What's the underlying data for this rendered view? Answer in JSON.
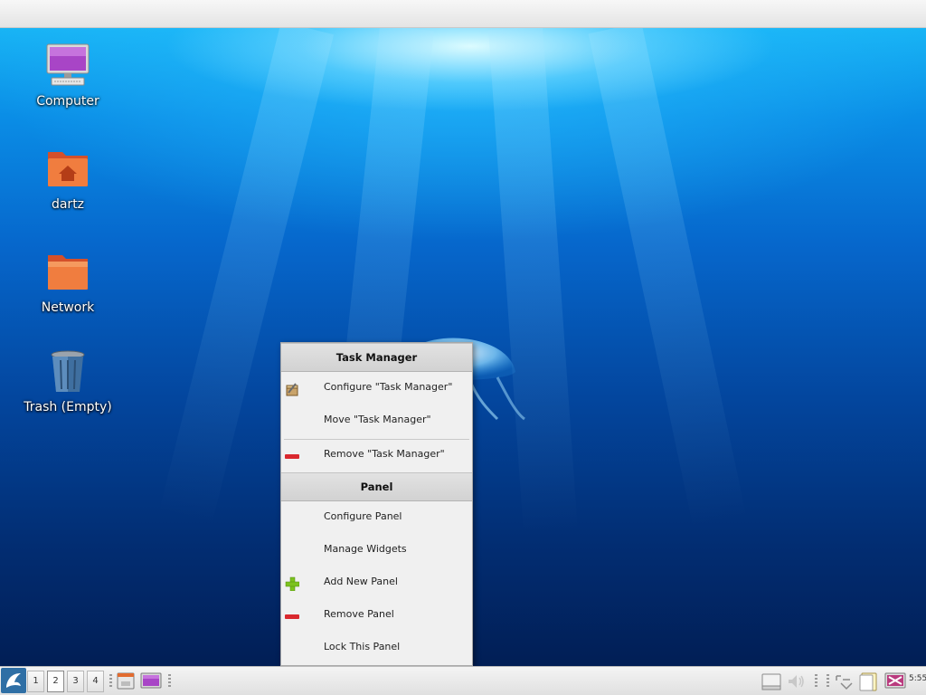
{
  "desktop": {
    "icons": [
      {
        "label": "Computer",
        "icon": "computer-icon"
      },
      {
        "label": "dartz",
        "icon": "home-folder-icon"
      },
      {
        "label": "Network",
        "icon": "network-folder-icon"
      },
      {
        "label": "Trash (Empty)",
        "icon": "trash-icon"
      }
    ]
  },
  "context_menu": {
    "sections": [
      {
        "header": "Task Manager",
        "items": [
          {
            "label": "Configure \"Task Manager\"",
            "icon": "configure-icon"
          },
          {
            "label": "Move \"Task Manager\"",
            "icon": ""
          },
          {
            "label": "Remove \"Task Manager\"",
            "icon": "remove-icon"
          }
        ]
      },
      {
        "header": "Panel",
        "items": [
          {
            "label": "Configure Panel",
            "icon": ""
          },
          {
            "label": "Manage Widgets",
            "icon": ""
          },
          {
            "label": "Add New Panel",
            "icon": "add-icon"
          },
          {
            "label": "Remove Panel",
            "icon": "remove-icon"
          },
          {
            "label": "Lock This Panel",
            "icon": ""
          }
        ]
      }
    ]
  },
  "panel": {
    "workspaces": [
      "1",
      "2",
      "3",
      "4"
    ],
    "active_workspace": "2",
    "clock": "5:55",
    "tray_icons": [
      "drive-icon",
      "volume-icon",
      "network-icon",
      "clipboard-icon",
      "display-icon"
    ],
    "launchers": [
      "kde-menu-icon",
      "file-manager-icon",
      "screen-icon"
    ]
  },
  "colors": {
    "menu_background": "#f0f0f0",
    "menu_header": "#d8d8d8",
    "remove_red": "#d9282e",
    "add_green": "#7cc21f"
  }
}
